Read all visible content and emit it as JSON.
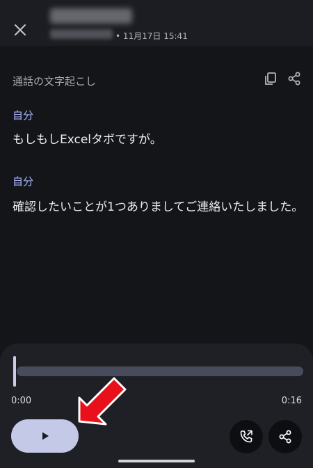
{
  "header": {
    "date": "• 11月17日 15:41"
  },
  "transcript": {
    "title": "通話の文字起こし",
    "entries": [
      {
        "speaker": "自分",
        "text": "もしもしExcelタボですが。"
      },
      {
        "speaker": "自分",
        "text": "確認したいことが1つありましてご連絡いたしました。"
      }
    ]
  },
  "player": {
    "current_time": "0:00",
    "duration": "0:16",
    "progress": 0
  },
  "icons": {
    "close": "close-icon",
    "copy": "copy-icon",
    "share": "share-icon",
    "play": "play-icon",
    "callback": "phone-callback-icon",
    "annotation": "red-arrow-icon"
  },
  "colors": {
    "background": "#141519",
    "speaker_label": "#a9b6ff",
    "play_button": "#c3c9e6",
    "annotation_arrow": "#e8101a"
  }
}
